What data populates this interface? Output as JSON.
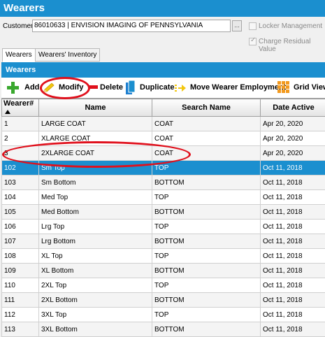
{
  "window": {
    "title": "Wearers"
  },
  "customer": {
    "label": "Customer",
    "value": "86010633    | ENVISION IMAGING OF PENNSYLVANIA",
    "lookup_label": "..."
  },
  "options": {
    "locker_management": "Locker Management",
    "charge_residual": "Charge Residual Value"
  },
  "tabs": [
    "Wearers",
    "Wearers' Inventory"
  ],
  "panel": {
    "title": "Wearers"
  },
  "toolbar": {
    "add": "Add",
    "modify": "Modify",
    "delete": "Delete",
    "duplicate": "Duplicate",
    "move": "Move Wearer Employment",
    "gridviews": "Grid Views"
  },
  "columns": [
    "Wearer#",
    "Name",
    "Search Name",
    "Date Active"
  ],
  "rows": [
    [
      "1",
      "LARGE COAT",
      "COAT",
      "Apr 20, 2020"
    ],
    [
      "2",
      "XLARGE COAT",
      "COAT",
      "Apr 20, 2020"
    ],
    [
      "3",
      "2XLARGE COAT",
      "COAT",
      "Apr 20, 2020"
    ],
    [
      "102",
      "Sm Top",
      "TOP",
      "Oct 11, 2018"
    ],
    [
      "103",
      "Sm Bottom",
      "BOTTOM",
      "Oct 11, 2018"
    ],
    [
      "104",
      "Med Top",
      "TOP",
      "Oct 11, 2018"
    ],
    [
      "105",
      "Med Bottom",
      "BOTTOM",
      "Oct 11, 2018"
    ],
    [
      "106",
      "Lrg Top",
      "TOP",
      "Oct 11, 2018"
    ],
    [
      "107",
      "Lrg Bottom",
      "BOTTOM",
      "Oct 11, 2018"
    ],
    [
      "108",
      "XL Top",
      "TOP",
      "Oct 11, 2018"
    ],
    [
      "109",
      "XL Bottom",
      "BOTTOM",
      "Oct 11, 2018"
    ],
    [
      "110",
      "2XL Top",
      "TOP",
      "Oct 11, 2018"
    ],
    [
      "111",
      "2XL Bottom",
      "BOTTOM",
      "Oct 11, 2018"
    ],
    [
      "112",
      "3XL Top",
      "TOP",
      "Oct 11, 2018"
    ],
    [
      "113",
      "3XL Bottom",
      "BOTTOM",
      "Oct 11, 2018"
    ]
  ],
  "selected_row": 3,
  "colors": {
    "accent": "#1b8fcf",
    "annotation": "#e0101c",
    "add_icon": "#3aa82e",
    "delete_icon": "#e0101c",
    "grid_icon": "#f39a1e"
  },
  "icons": [
    "plus-icon",
    "pencil-icon",
    "minus-icon",
    "duplicate-icon",
    "move-arrow-icon",
    "grid-views-icon"
  ]
}
